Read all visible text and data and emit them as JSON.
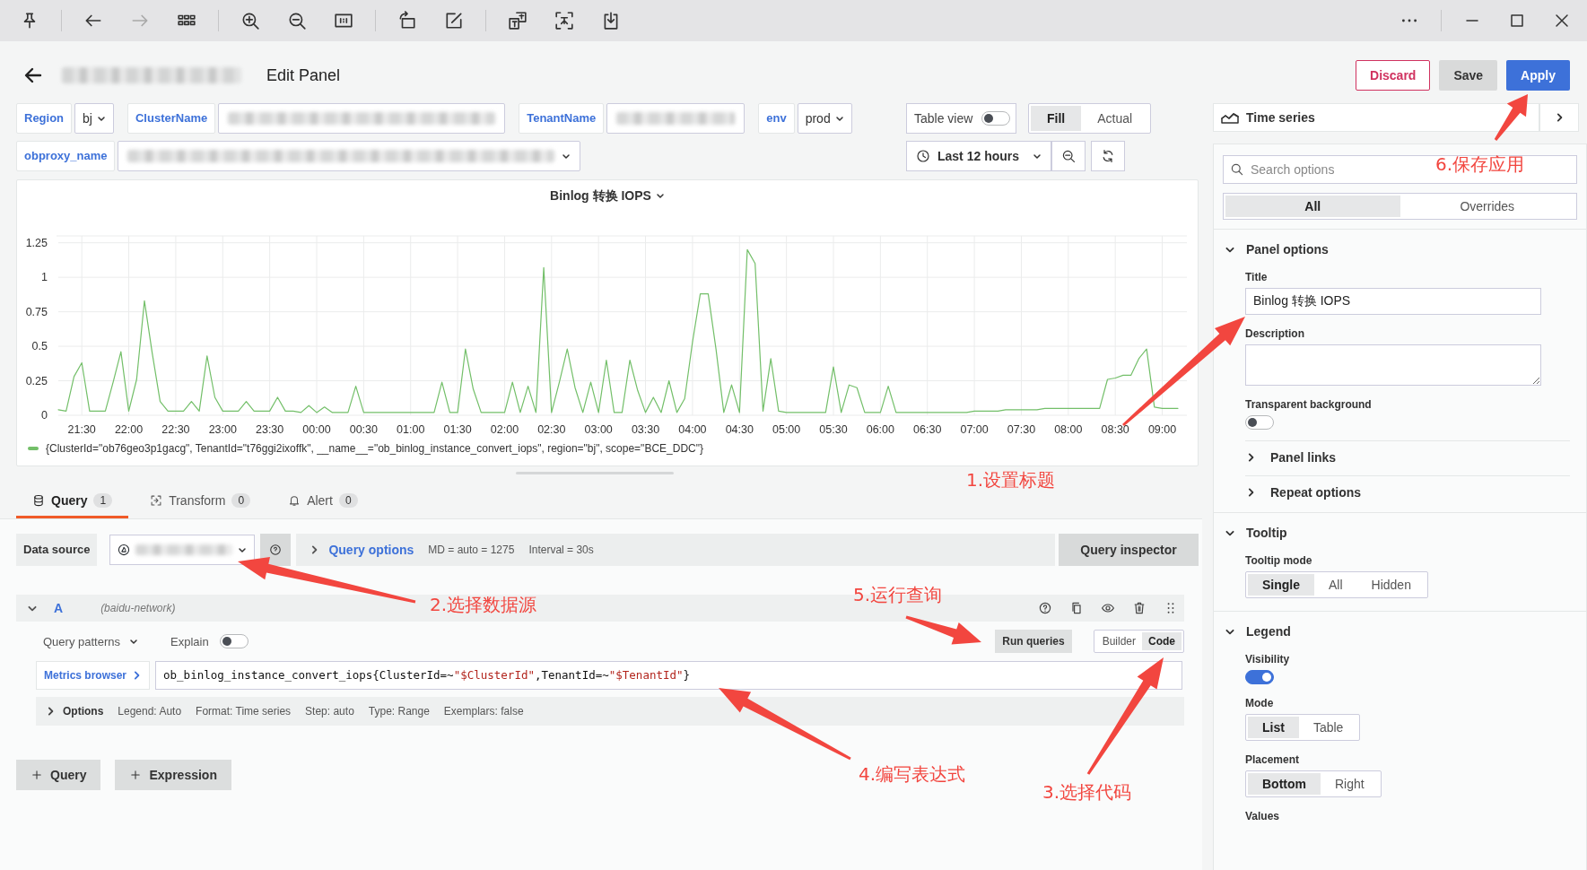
{
  "toolbar_buttons": [
    {
      "kind": "pin",
      "disabled": false
    },
    {
      "kind": "back",
      "disabled": false
    },
    {
      "kind": "forward",
      "disabled": true
    },
    {
      "kind": "apps",
      "disabled": false
    },
    {
      "kind": "zoom-in",
      "disabled": false
    },
    {
      "kind": "zoom-out",
      "disabled": false
    },
    {
      "kind": "actual-size",
      "disabled": false
    },
    {
      "kind": "rotate",
      "disabled": false
    },
    {
      "kind": "edit",
      "disabled": false
    },
    {
      "kind": "translate",
      "disabled": false
    },
    {
      "kind": "screen-translate",
      "disabled": false
    },
    {
      "kind": "download",
      "disabled": false
    }
  ],
  "header": {
    "title": "Edit Panel",
    "buttons": [
      {
        "label": "Discard",
        "kind": "danger"
      },
      {
        "label": "Save",
        "kind": "secondary"
      },
      {
        "label": "Apply",
        "kind": "primary"
      }
    ]
  },
  "variable_rows": [
    [
      {
        "label": "Region",
        "kind": "select",
        "value": "bj"
      },
      {
        "label": "ClusterName",
        "kind": "redacted"
      },
      {
        "label": "TenantName",
        "kind": "redacted"
      },
      {
        "label": "env",
        "kind": "select",
        "value": "prod"
      }
    ],
    [
      {
        "label": "obproxy_name",
        "kind": "redacted-select"
      }
    ]
  ],
  "view_controls": {
    "table_view": {
      "label": "Table view",
      "on": false
    },
    "fill_modes": [
      {
        "label": "Fill",
        "selected": true
      },
      {
        "label": "Actual",
        "selected": false
      }
    ],
    "time_range": "Last 12 hours"
  },
  "panel": {
    "chart_data": {
      "type": "line",
      "title": "Binlog 转换 IOPS",
      "ylim": [
        0,
        1.3
      ],
      "grid": true,
      "yticks": [
        0,
        0.25,
        0.5,
        0.75,
        1,
        1.25
      ],
      "categories": [
        null,
        null,
        null,
        "21:30",
        null,
        null,
        null,
        null,
        null,
        "22:00",
        null,
        null,
        null,
        null,
        null,
        "22:30",
        null,
        null,
        null,
        null,
        null,
        "23:00",
        null,
        null,
        null,
        null,
        null,
        "23:30",
        null,
        null,
        null,
        null,
        null,
        "00:00",
        null,
        null,
        null,
        null,
        null,
        "00:30",
        null,
        null,
        null,
        null,
        null,
        "01:00",
        null,
        null,
        null,
        null,
        null,
        "01:30",
        null,
        null,
        null,
        null,
        null,
        "02:00",
        null,
        null,
        null,
        null,
        null,
        "02:30",
        null,
        null,
        null,
        null,
        null,
        "03:00",
        null,
        null,
        null,
        null,
        null,
        "03:30",
        null,
        null,
        null,
        null,
        null,
        "04:00",
        null,
        null,
        null,
        null,
        null,
        "04:30",
        null,
        null,
        null,
        null,
        null,
        "05:00",
        null,
        null,
        null,
        null,
        null,
        "05:30",
        null,
        null,
        null,
        null,
        null,
        "06:00",
        null,
        null,
        null,
        null,
        null,
        "06:30",
        null,
        null,
        null,
        null,
        null,
        "07:00",
        null,
        null,
        null,
        null,
        null,
        "07:30",
        null,
        null,
        null,
        null,
        null,
        "08:00",
        null,
        null,
        null,
        null,
        null,
        "08:30",
        null,
        null,
        null,
        null,
        null,
        "09:00",
        null,
        null
      ],
      "series": [
        {
          "name": "{ClusterId=\"ob76geo3p1gacg\", TenantId=\"t76ggi2ixoffk\", __name__=\"ob_binlog_instance_convert_iops\", region=\"bj\", scope=\"BCE_DDC\"}",
          "color": "#73bf69",
          "values": [
            0.04,
            0.03,
            0.28,
            0.38,
            0.03,
            0.03,
            0.03,
            0.24,
            0.46,
            0.03,
            0.26,
            0.83,
            0.45,
            0.1,
            0.03,
            0.03,
            0.03,
            0.1,
            0.03,
            0.43,
            0.13,
            0.03,
            0.03,
            0.03,
            0.1,
            0.03,
            0.03,
            0.03,
            0.13,
            0.03,
            0.03,
            0.02,
            0.07,
            0.02,
            0.06,
            0.02,
            0.02,
            0.02,
            0.21,
            0.02,
            0.02,
            0.02,
            0.02,
            0.02,
            0.02,
            0.02,
            0.02,
            0.02,
            0.02,
            0.24,
            0.02,
            0.02,
            0.48,
            0.19,
            0.02,
            0.02,
            0.02,
            0.02,
            0.24,
            0.02,
            0.21,
            0.02,
            1.07,
            0.02,
            0.24,
            0.48,
            0.2,
            0.02,
            0.24,
            0.02,
            0.4,
            0.02,
            0.02,
            0.4,
            0.18,
            0.02,
            0.13,
            0.02,
            0.25,
            0.02,
            0.12,
            0.53,
            0.88,
            0.88,
            0.48,
            0.02,
            0.22,
            0.02,
            1.2,
            1.1,
            0.03,
            0.41,
            0.03,
            0.02,
            0.02,
            0.02,
            0.02,
            0.02,
            0.02,
            0.35,
            0.02,
            0.22,
            0.2,
            0.02,
            0.02,
            0.02,
            0.21,
            0.02,
            0.02,
            0.02,
            0.02,
            0.02,
            0.02,
            0.02,
            0.02,
            0.02,
            0.02,
            0.03,
            0.03,
            0.03,
            0.03,
            0.04,
            0.04,
            0.04,
            0.04,
            0.04,
            0.05,
            0.05,
            0.05,
            0.05,
            0.05,
            0.05,
            0.05,
            0.05,
            0.26,
            0.27,
            0.29,
            0.29,
            0.41,
            0.48,
            0.06,
            0.05,
            0.05,
            0.05
          ]
        }
      ]
    }
  },
  "query_tabs": [
    {
      "label": "Query",
      "count": "1",
      "selected": true
    },
    {
      "label": "Transform",
      "count": "0",
      "selected": false
    },
    {
      "label": "Alert",
      "count": "0",
      "selected": false
    }
  ],
  "query_editor": {
    "data_source_label": "Data source",
    "query_options": "Query options",
    "md": "MD = auto = 1275",
    "interval": "Interval = 30s",
    "inspector": "Query inspector",
    "query": {
      "ref": "A",
      "datasource": "(baidu-network)",
      "patterns": "Query patterns",
      "explain": {
        "label": "Explain",
        "on": false
      },
      "run": "Run queries",
      "modes": [
        {
          "label": "Builder",
          "selected": false
        },
        {
          "label": "Code",
          "selected": true
        }
      ],
      "metrics_browser": "Metrics browser",
      "expression": [
        {
          "kind": "plain",
          "text": "ob_binlog_instance_convert_iops{ClusterId=~"
        },
        {
          "kind": "string",
          "text": "\"$ClusterId\""
        },
        {
          "kind": "plain",
          "text": ",TenantId=~"
        },
        {
          "kind": "string",
          "text": "\"$TenantId\""
        },
        {
          "kind": "plain",
          "text": "}"
        }
      ],
      "options_label": "Options",
      "options": [
        "Legend: Auto",
        "Format: Time series",
        "Step: auto",
        "Type: Range",
        "Exemplars: false"
      ]
    },
    "add_buttons": [
      "Query",
      "Expression"
    ]
  },
  "options_pane": {
    "visualization": "Time series",
    "search_placeholder": "Search options",
    "tabs": [
      {
        "label": "All",
        "selected": true
      },
      {
        "label": "Overrides",
        "selected": false
      }
    ],
    "panel_options": {
      "heading": "Panel options",
      "expanded": true,
      "title_label": "Title",
      "title_value": "Binlog 转换 IOPS",
      "description_label": "Description",
      "transparent": {
        "label": "Transparent background",
        "on": false
      },
      "subsections": [
        {
          "label": "Panel links",
          "expanded": false
        },
        {
          "label": "Repeat options",
          "expanded": false
        }
      ]
    },
    "tooltip": {
      "heading": "Tooltip",
      "expanded": true,
      "mode_label": "Tooltip mode",
      "modes": [
        {
          "label": "Single",
          "selected": true
        },
        {
          "label": "All",
          "selected": false
        },
        {
          "label": "Hidden",
          "selected": false
        }
      ]
    },
    "legend": {
      "heading": "Legend",
      "expanded": true,
      "visibility": {
        "label": "Visibility",
        "on": true
      },
      "mode_label": "Mode",
      "modes": [
        {
          "label": "List",
          "selected": true
        },
        {
          "label": "Table",
          "selected": false
        }
      ],
      "placement_label": "Placement",
      "placements": [
        {
          "label": "Bottom",
          "selected": true
        },
        {
          "label": "Right",
          "selected": false
        }
      ],
      "values_label": "Values"
    }
  },
  "annotations": [
    {
      "text": "1.设置标题"
    },
    {
      "text": "2.选择数据源"
    },
    {
      "text": "3.选择代码"
    },
    {
      "text": "4.编写表达式"
    },
    {
      "text": "5.运行查询"
    },
    {
      "text": "6.保存应用"
    }
  ]
}
